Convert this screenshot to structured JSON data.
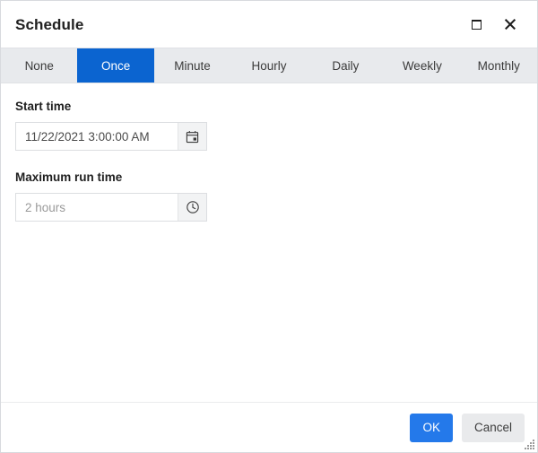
{
  "dialog": {
    "title": "Schedule",
    "maximize_icon": "maximize-icon",
    "close_icon": "close-icon"
  },
  "tabs": [
    {
      "label": "None",
      "active": false
    },
    {
      "label": "Once",
      "active": true
    },
    {
      "label": "Minute",
      "active": false
    },
    {
      "label": "Hourly",
      "active": false
    },
    {
      "label": "Daily",
      "active": false
    },
    {
      "label": "Weekly",
      "active": false
    },
    {
      "label": "Monthly",
      "active": false
    }
  ],
  "fields": {
    "start_time": {
      "label": "Start time",
      "value": "11/22/2021 3:00:00 AM",
      "placeholder": "",
      "icon": "calendar-icon"
    },
    "maximum_run_time": {
      "label": "Maximum run time",
      "value": "",
      "placeholder": "2 hours",
      "icon": "clock-icon"
    }
  },
  "footer": {
    "ok_label": "OK",
    "cancel_label": "Cancel"
  },
  "colors": {
    "tab_active": "#0b64d0",
    "primary_button": "#2479ea",
    "tabstrip_background": "#e8eaed",
    "secondary_button": "#e9eaec"
  }
}
